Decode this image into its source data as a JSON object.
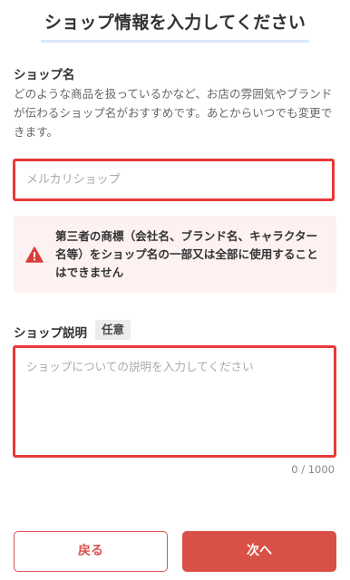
{
  "header": {
    "title": "ショップ情報を入力してください"
  },
  "shop_name": {
    "label": "ショップ名",
    "description": "どのような商品を扱っているかなど、お店の雰囲気やブランドが伝わるショップ名がおすすめです。あとからいつでも変更できます。",
    "placeholder": "メルカリショップ",
    "value": ""
  },
  "warning": {
    "icon": "warning-triangle-icon",
    "text": "第三者の商標（会社名、ブランド名、キャラクター名等）をショップ名の一部又は全部に使用することはできません",
    "color": "#d93c3c"
  },
  "shop_description": {
    "label": "ショップ説明",
    "optional_badge": "任意",
    "placeholder": "ショップについての説明を入力してください",
    "value": "",
    "counter": "0 / 1000"
  },
  "buttons": {
    "back_label": "戻る",
    "next_label": "次へ"
  },
  "colors": {
    "accent": "#d95046",
    "highlight_border": "#e83838",
    "title_underline": "#dbe9f7",
    "warning_bg": "#fdf1f1"
  }
}
